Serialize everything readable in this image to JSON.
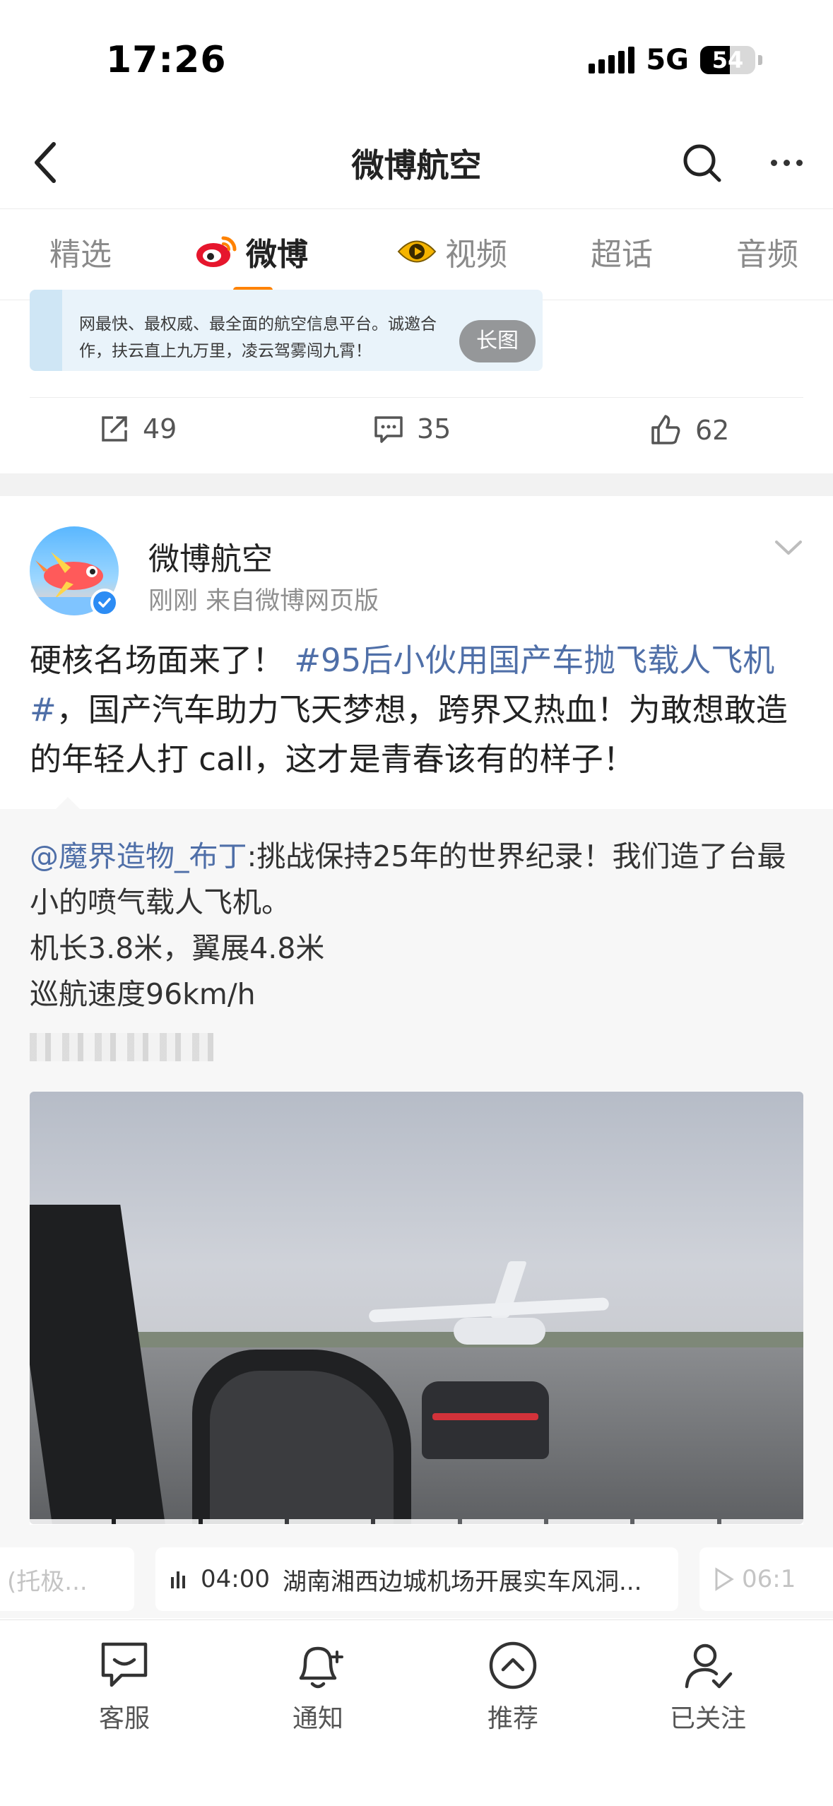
{
  "status_bar": {
    "time": "17:26",
    "network": "5G",
    "battery": "54",
    "battery_level_percent": 54
  },
  "nav": {
    "title": "微博航空",
    "back_icon": "chevron-left-icon",
    "search_icon": "search-icon",
    "more_icon": "more-dots-icon"
  },
  "tabs": [
    {
      "label": "精选",
      "active": false
    },
    {
      "label": "微博",
      "active": true,
      "icon": "weibo-logo-icon"
    },
    {
      "label": "视频",
      "active": false,
      "icon": "video-eye-icon"
    },
    {
      "label": "超话",
      "active": false
    },
    {
      "label": "音频",
      "active": false
    }
  ],
  "prev_post": {
    "card_lines": [
      "网最快、最权威、最全面的航空信息平台。诚邀合",
      "作，扶云直上九万里，凌云驾雾闯九霄！"
    ],
    "long_image_badge": "长图",
    "actions": {
      "repost": "49",
      "comment": "35",
      "like": "62"
    }
  },
  "post": {
    "author": "微博航空",
    "meta": "刚刚  来自微博网页版",
    "text_before": "硬核名场面来了！ ",
    "topic": "#95后小伙用国产车抛飞载人飞机#",
    "text_after": "，国产汽车助力飞天梦想，跨界又热血！为敢想敢造的年轻人打 call，这才是青春该有的样子！"
  },
  "repost": {
    "mention": "@魔界造物_布丁",
    "text": ":挑战保持25年的世界纪录！我们造了台最小的喷气载人飞机。",
    "line2": "机长3.8米，翼展4.8米",
    "line3": "巡航速度96km/h"
  },
  "video_chips": {
    "left": "(托极...",
    "center_time": "04:00",
    "center_title": "湖南湘西边城机场开展实车风洞...",
    "right_time": "06:1"
  },
  "bottom_bar": [
    {
      "label": "客服",
      "icon": "chat-bubble-icon"
    },
    {
      "label": "通知",
      "icon": "bell-add-icon"
    },
    {
      "label": "推荐",
      "icon": "up-circle-icon"
    },
    {
      "label": "已关注",
      "icon": "user-check-icon"
    }
  ]
}
